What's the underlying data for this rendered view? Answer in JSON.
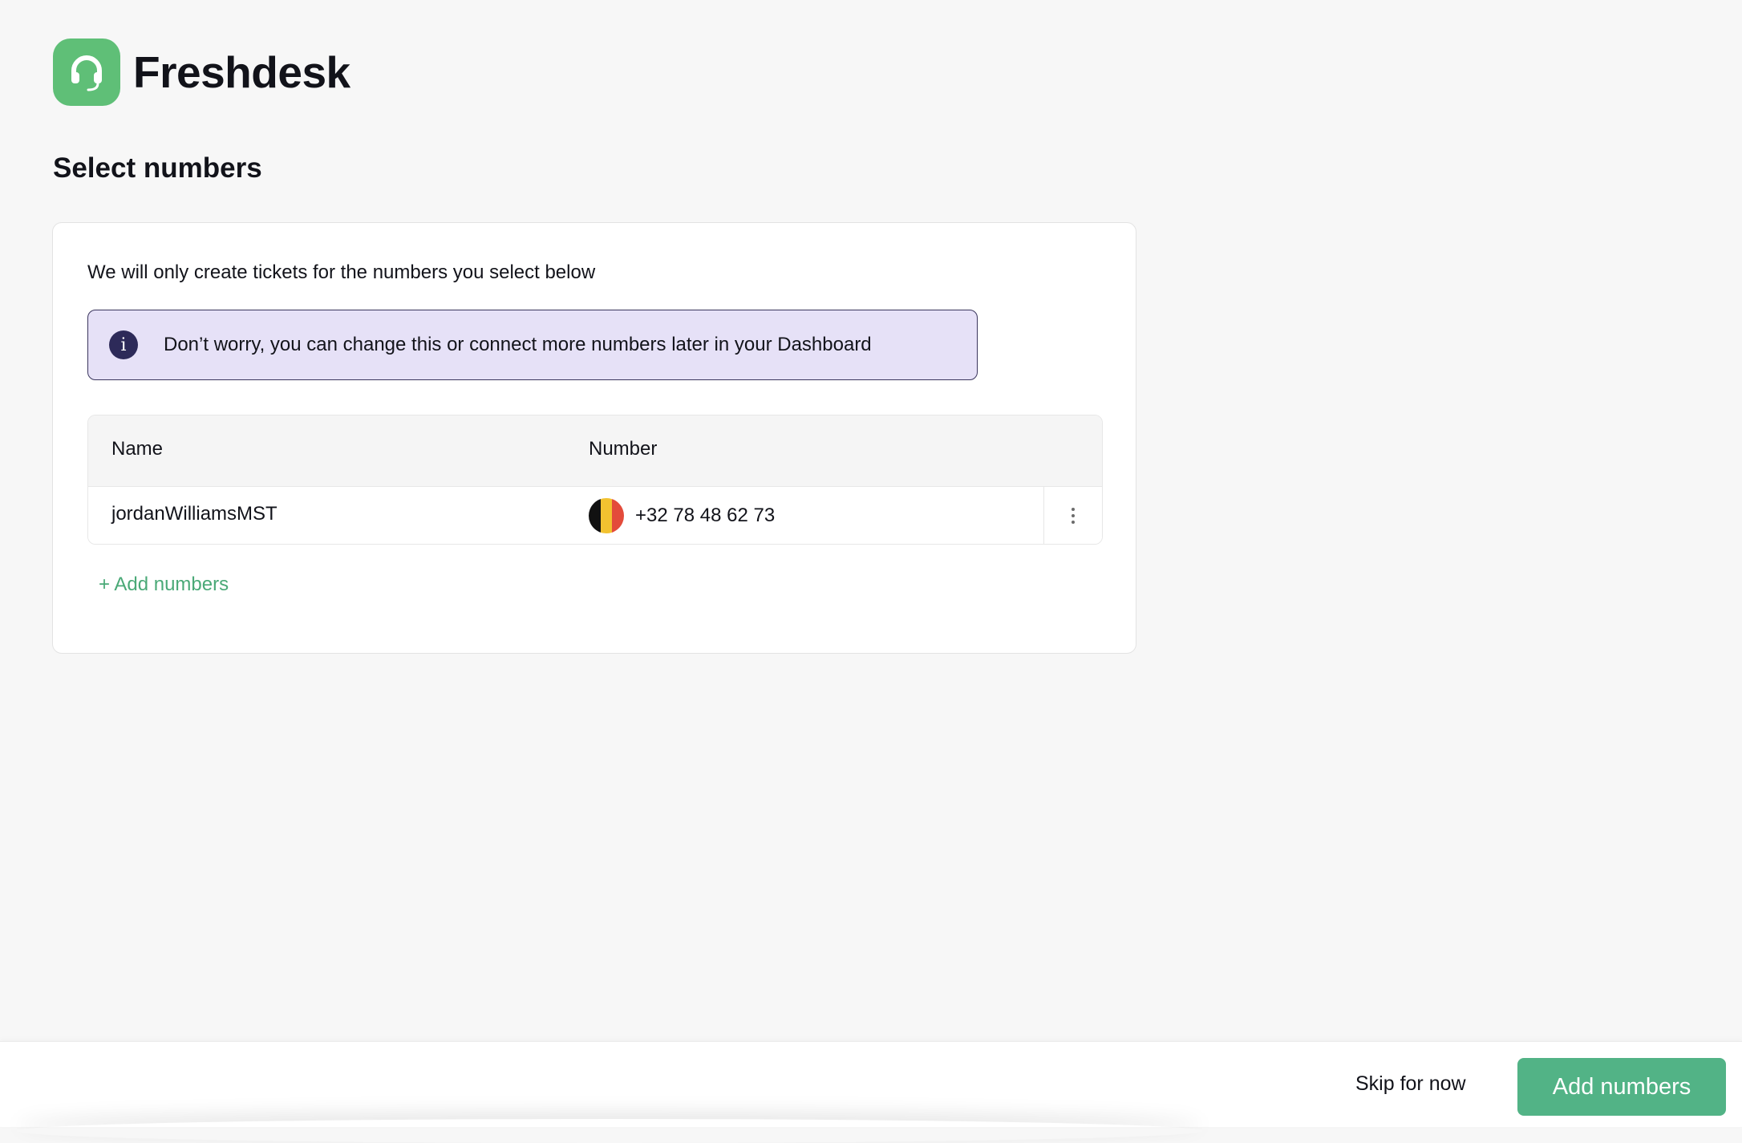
{
  "brand": {
    "name": "Freshdesk",
    "logo_color": "#5fbf77"
  },
  "page": {
    "title": "Select numbers"
  },
  "card": {
    "intro": "We will only create tickets for the numbers you select below",
    "info_banner": {
      "icon": "info-icon",
      "text": "Don’t worry, you can change this or connect more numbers later in your Dashboard",
      "bg_color": "#e6e1f7",
      "border_color": "#3a355d"
    },
    "table": {
      "columns": [
        "Name",
        "Number"
      ],
      "rows": [
        {
          "name": "jordanWilliamsMST",
          "flag": "belgium-flag-icon",
          "number": "+32 78 48 62 73"
        }
      ]
    },
    "add_link": "+ Add numbers",
    "accent_color": "#4aa977"
  },
  "footer": {
    "skip_label": "Skip for now",
    "primary_label": "Add numbers",
    "primary_color": "#52b386"
  }
}
